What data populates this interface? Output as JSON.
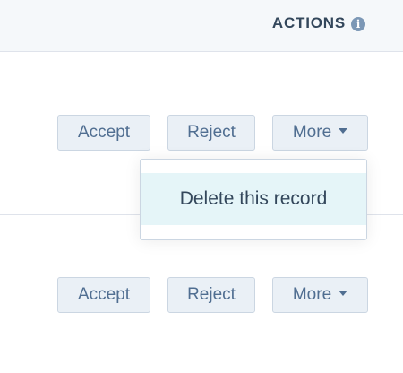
{
  "header": {
    "title": "ACTIONS",
    "info_icon": "info-icon",
    "info_glyph": "i"
  },
  "rows": [
    {
      "accept_label": "Accept",
      "reject_label": "Reject",
      "more_label": "More"
    },
    {
      "accept_label": "Accept",
      "reject_label": "Reject",
      "more_label": "More"
    }
  ],
  "dropdown": {
    "items": [
      {
        "label": "Delete this record"
      }
    ]
  },
  "colors": {
    "header_bg": "#f5f8fa",
    "button_bg": "#eaf0f6",
    "button_border": "#cbd6e2",
    "button_text": "#506e91",
    "text_primary": "#33475b",
    "dropdown_hover_bg": "#e5f5f8",
    "info_icon_bg": "#7c98b6"
  }
}
